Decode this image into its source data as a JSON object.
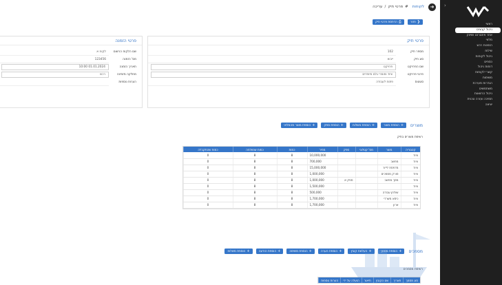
{
  "sidebar": {
    "items": [
      {
        "label": "ראשי",
        "active": false
      },
      {
        "label": "ניהול קבצים",
        "active": true
      },
      {
        "label": "אתר אינטרנט ושיווק",
        "active": false
      },
      {
        "label": "מלאי",
        "active": false
      },
      {
        "label": "הזמנות רכש",
        "active": false
      },
      {
        "label": "שילוח",
        "active": false
      },
      {
        "label": "ניהול לקוחות",
        "active": false
      },
      {
        "label": "כספים",
        "active": false
      },
      {
        "label": "דוחות ניהול",
        "active": false
      },
      {
        "label": "קשרי לקוחות",
        "active": false
      },
      {
        "label": "משימות",
        "active": false
      },
      {
        "label": "הגדרות מערכת",
        "active": false
      },
      {
        "label": "משתמשים",
        "active": false
      },
      {
        "label": "ניהול הרשאות",
        "active": false
      },
      {
        "label": "תמיכה ועזרה טכנית",
        "active": false
      },
      {
        "label": "יציאה",
        "active": false
      }
    ]
  },
  "topbar": {
    "link": "לקוחות",
    "crumb_sep": "#",
    "crumb_1": "פרטי תיק",
    "crumb_2": "עריכה"
  },
  "top_buttons": {
    "back": "חזור",
    "print_file": "הדפסת פרטי תיק"
  },
  "card_details": {
    "title": "פרטי תיק",
    "rows": [
      {
        "label": "מספר תיק",
        "value": "102"
      },
      {
        "label": "סוג תיק",
        "value": "ייבוא"
      },
      {
        "label": "שם הפרויקט",
        "value": "פרויקט"
      },
      {
        "label": "פרטי פרויקט",
        "value": "ציוד וחומרי גלם מיוחדים"
      },
      {
        "label": "סטטוס",
        "value": "פתוח לעבודה"
      }
    ]
  },
  "card_customer": {
    "title": "פרטי הזמנה",
    "rows": [
      {
        "label": "שם הלקוח הרשום",
        "value": "לקוח א"
      },
      {
        "label": "מס' הזמנה",
        "value": "123456"
      },
      {
        "label": "תאריך הזמנה",
        "value": "01.01.2024 10:00"
      },
      {
        "label": "מחלקה מזמינה",
        "value": "רכש"
      },
      {
        "label": "הערות נוספות",
        "value": ""
      }
    ]
  },
  "products": {
    "title": "מוצרים",
    "buttons": [
      "הוספת מוצר",
      "הוספת משלוח",
      "הוספת ספק",
      "הוספת מוצר מהמלאי"
    ],
    "subtitle": "רשימת מוצרים בתיק",
    "columns": [
      "קטגוריה",
      "מוצר",
      "מס' קטלוגי",
      "ספק",
      "מחיר",
      "כמות",
      "כמות שנשלחה",
      "כמות שהתקבלה"
    ],
    "rows": [
      [
        "ציוד",
        "",
        "",
        "",
        "10,000,000",
        "8",
        "8",
        "0"
      ],
      [
        "ציוד",
        "מחשב",
        "",
        "",
        "700,000",
        "8",
        "8",
        "0"
      ],
      [
        "ציוד",
        "מדפסת לייזר",
        "",
        "",
        "15,000,000",
        "8",
        "8",
        "0"
      ],
      [
        "ציוד",
        "סורק מסמכים",
        "",
        "",
        "1,000,000",
        "8",
        "8",
        "0"
      ],
      [
        "ציוד",
        "מסך מחשב",
        "",
        "ספק א",
        "1,000,000",
        "8",
        "8",
        "0"
      ],
      [
        "ציוד",
        "",
        "",
        "",
        "1,500,000",
        "8",
        "8",
        "0"
      ],
      [
        "ציוד",
        "שולחן עבודה",
        "",
        "",
        "500,000",
        "8",
        "8",
        "0"
      ],
      [
        "ציוד",
        "כיסא משרדי",
        "",
        "",
        "1,700,000",
        "8",
        "8",
        "0"
      ],
      [
        "ציוד",
        "ארון",
        "",
        "",
        "1,700,000",
        "8",
        "8",
        "0"
      ]
    ]
  },
  "documents": {
    "title": "מסמכים",
    "buttons": [
      "הוספת מסמך",
      "העלאת קובץ",
      "הוספת הערה",
      "הוספת משימה",
      "הוספת הודעה",
      "הוספת משלוח"
    ],
    "subtitle": "רשימת מסמכים",
    "columns": [
      "סוג מסמך",
      "תאריך",
      "שם הקובץ",
      "תיאור",
      "הועלה על ידי",
      "הערות נוספות"
    ]
  }
}
